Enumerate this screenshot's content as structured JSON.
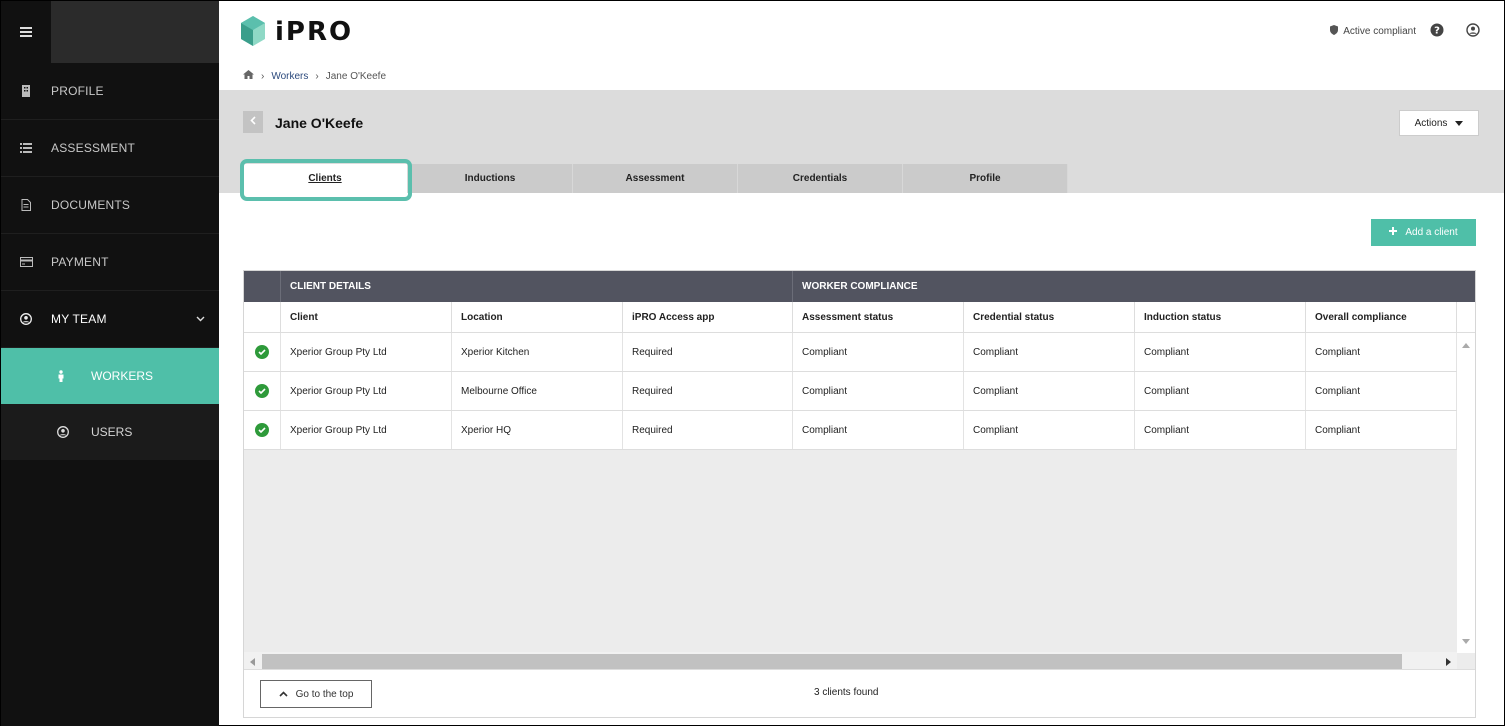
{
  "brand": {
    "name": "iPRO",
    "accent": "#4fbfa8"
  },
  "header": {
    "status_label": "Active compliant"
  },
  "sidebar": {
    "items": [
      {
        "label": "PROFILE",
        "icon": "building-icon"
      },
      {
        "label": "ASSESSMENT",
        "icon": "list-icon"
      },
      {
        "label": "DOCUMENTS",
        "icon": "document-icon"
      },
      {
        "label": "PAYMENT",
        "icon": "credit-card-icon"
      },
      {
        "label": "MY TEAM",
        "icon": "user-circle-icon"
      }
    ],
    "subitems": [
      {
        "label": "WORKERS",
        "icon": "person-icon",
        "active": true
      },
      {
        "label": "USERS",
        "icon": "user-circle-icon",
        "active": false
      }
    ]
  },
  "breadcrumb": {
    "link": "Workers",
    "current": "Jane O'Keefe"
  },
  "page": {
    "title": "Jane O'Keefe",
    "actions_label": "Actions"
  },
  "tabs": [
    "Clients",
    "Inductions",
    "Assessment",
    "Credentials",
    "Profile"
  ],
  "add_client_label": "Add a client",
  "table": {
    "group_headers": [
      "CLIENT DETAILS",
      "WORKER COMPLIANCE"
    ],
    "columns": [
      "Client",
      "Location",
      "iPRO Access app",
      "Assessment status",
      "Credential status",
      "Induction status",
      "Overall compliance"
    ],
    "rows": [
      [
        "Xperior Group Pty Ltd",
        "Xperior Kitchen",
        "Required",
        "Compliant",
        "Compliant",
        "Compliant",
        "Compliant"
      ],
      [
        "Xperior Group Pty Ltd",
        "Melbourne Office",
        "Required",
        "Compliant",
        "Compliant",
        "Compliant",
        "Compliant"
      ],
      [
        "Xperior Group Pty Ltd",
        "Xperior HQ",
        "Required",
        "Compliant",
        "Compliant",
        "Compliant",
        "Compliant"
      ]
    ]
  },
  "footer": {
    "go_top_label": "Go to the top",
    "count_text": "3 clients found"
  }
}
